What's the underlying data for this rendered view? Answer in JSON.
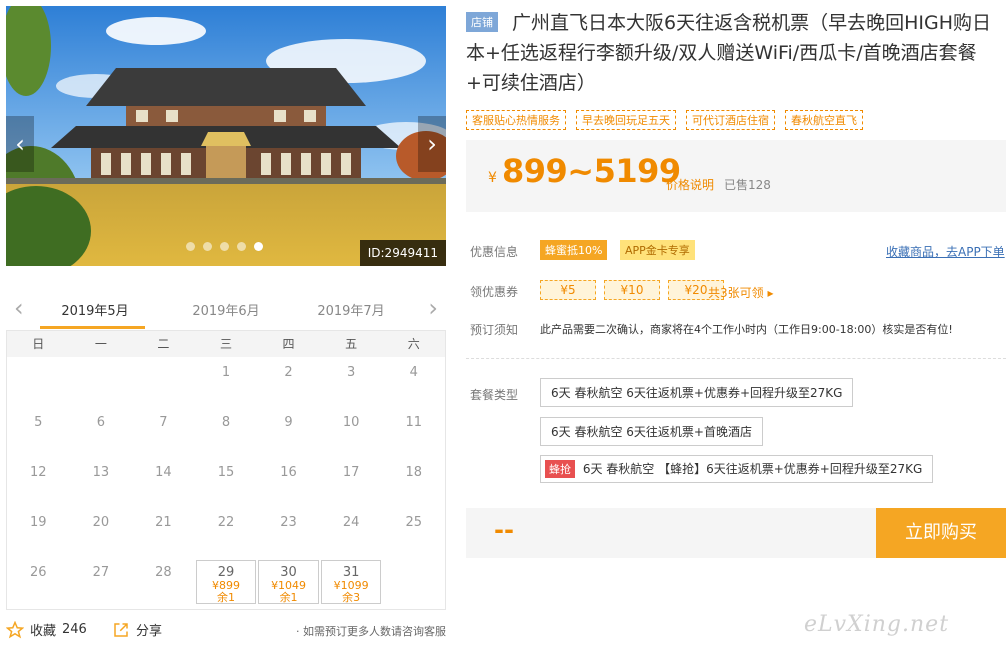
{
  "gallery": {
    "image_id": "ID:2949411",
    "dot_count": 5,
    "active_dot": 4,
    "prev": "‹",
    "next": "›"
  },
  "calendar": {
    "prev": "‹",
    "next": "›",
    "months": [
      "2019年5月",
      "2019年6月",
      "2019年7月"
    ],
    "active_month": 0,
    "weekdays": [
      "日",
      "一",
      "二",
      "三",
      "四",
      "五",
      "六"
    ],
    "lead_blank": 3,
    "days": 31,
    "available": [
      {
        "day": 29,
        "price": "¥899",
        "stock": "余1"
      },
      {
        "day": 30,
        "price": "¥1049",
        "stock": "余1"
      },
      {
        "day": 31,
        "price": "¥1099",
        "stock": "余3"
      }
    ]
  },
  "bottom": {
    "fav_label": "收藏",
    "fav_count": "246",
    "share_label": "分享",
    "note": "· 如需预订更多人数请咨询客服"
  },
  "product": {
    "shop_tag": "店铺",
    "title": "广州直飞日本大阪6天往返含税机票（早去晚回HIGH购日本+任选返程行李额升级/双人赠送WiFi/西瓜卡/首晚酒店套餐+可续住酒店）",
    "features": [
      "客服贴心热情服务",
      "早去晚回玩足五天",
      "可代订酒店住宿",
      "春秋航空直飞"
    ]
  },
  "price": {
    "symbol": "¥",
    "range": "899~5199",
    "explain": "价格说明",
    "sold": "已售128"
  },
  "promo": {
    "label": "优惠信息",
    "badge1": "蜂蜜抵10%",
    "badge2": "APP金卡专享",
    "fav_link": "收藏商品，去APP下单"
  },
  "coupons": {
    "label": "领优惠券",
    "items": [
      "¥5",
      "¥10",
      "¥20"
    ],
    "more": "共3张可领 ▸"
  },
  "notice": {
    "label": "预订须知",
    "text": "此产品需要二次确认，商家将在4个工作小时内（工作日9:00-18:00）核实是否有位!"
  },
  "packages": {
    "label": "套餐类型",
    "items": [
      {
        "tag": "",
        "text": "6天 春秋航空 6天往返机票+优惠券+回程升级至27KG"
      },
      {
        "tag": "",
        "text": "6天 春秋航空 6天往返机票+首晚酒店"
      },
      {
        "tag": "蜂抢",
        "text": "6天 春秋航空 【蜂抢】6天往返机票+优惠券+回程升级至27KG"
      }
    ]
  },
  "buy": {
    "qty": "--",
    "button": "立即购买"
  },
  "watermark": "eLvXing.net",
  "colors": {
    "accent": "#f5a623",
    "price": "#f08a00",
    "link": "#3a6fb5",
    "shop_tag": "#7ea7d8",
    "flash_tag": "#e85050"
  }
}
